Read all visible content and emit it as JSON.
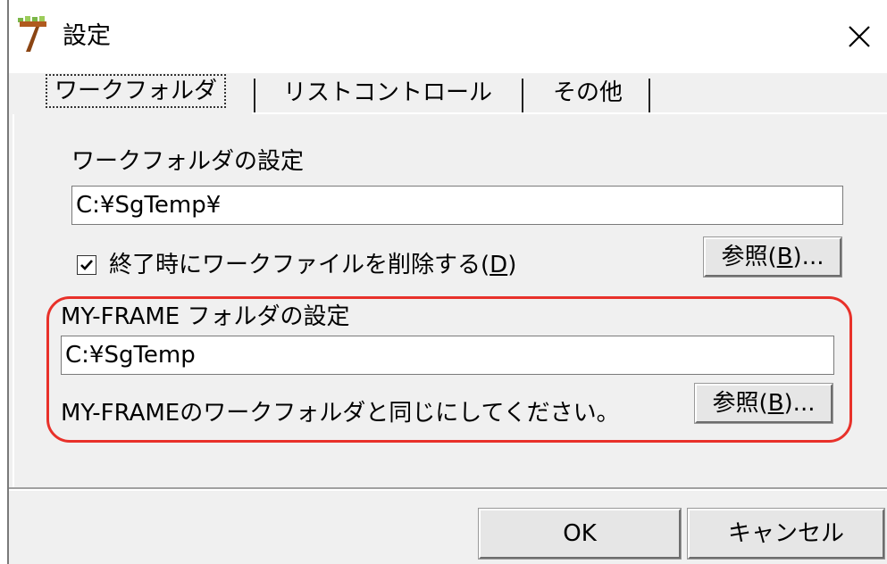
{
  "window": {
    "title": "設定",
    "close_glyph": "✕",
    "icon": "app-icon"
  },
  "tabs": [
    {
      "label": "ワークフォルダ",
      "active": true
    },
    {
      "label": "リストコントロール",
      "active": false
    },
    {
      "label": "その他",
      "active": false
    }
  ],
  "work_folder": {
    "section_label": "ワークフォルダの設定",
    "path_value": "C:¥SgTemp¥",
    "delete_checkbox": {
      "checked": true,
      "label_before": "終了時にワークファイルを削除する(",
      "mnemonic": "D",
      "label_after": ")"
    },
    "browse_button": {
      "label_before": "参照(",
      "mnemonic": "B",
      "label_after": ")..."
    }
  },
  "myframe_folder": {
    "section_label": "MY-FRAME フォルダの設定",
    "path_value": "C:¥SgTemp",
    "note": "MY-FRAMEのワークフォルダと同じにしてください。",
    "browse_button": {
      "label_before": "参照(",
      "mnemonic": "B",
      "label_after": ")..."
    }
  },
  "footer": {
    "ok_label": "OK",
    "cancel_label": "キャンセル"
  },
  "colors": {
    "dialog_bg": "#f0f0f0",
    "highlight_border": "#e8312a"
  }
}
